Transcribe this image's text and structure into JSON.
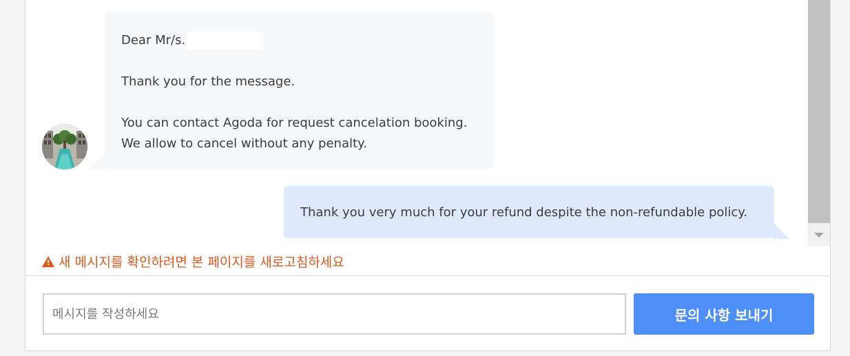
{
  "conversation": {
    "incoming": {
      "greeting": "Dear Mr/s.",
      "line_thanks": "Thank you for the message.",
      "line_contact": "You can contact Agoda for request cancelation booking.",
      "line_allow": "We allow to cancel without any penalty."
    },
    "outgoing": {
      "text": "Thank you very much for your refund despite the non-refundable policy."
    }
  },
  "notice": {
    "icon": "warning-icon",
    "text": "새 메시지를 확인하려면 본 페이지를 새로고침하세요",
    "color": "#e2571b"
  },
  "composer": {
    "placeholder": "메시지를 작성하세요",
    "send_label": "문의 사항 보내기",
    "accent": "#4e8ef7"
  }
}
